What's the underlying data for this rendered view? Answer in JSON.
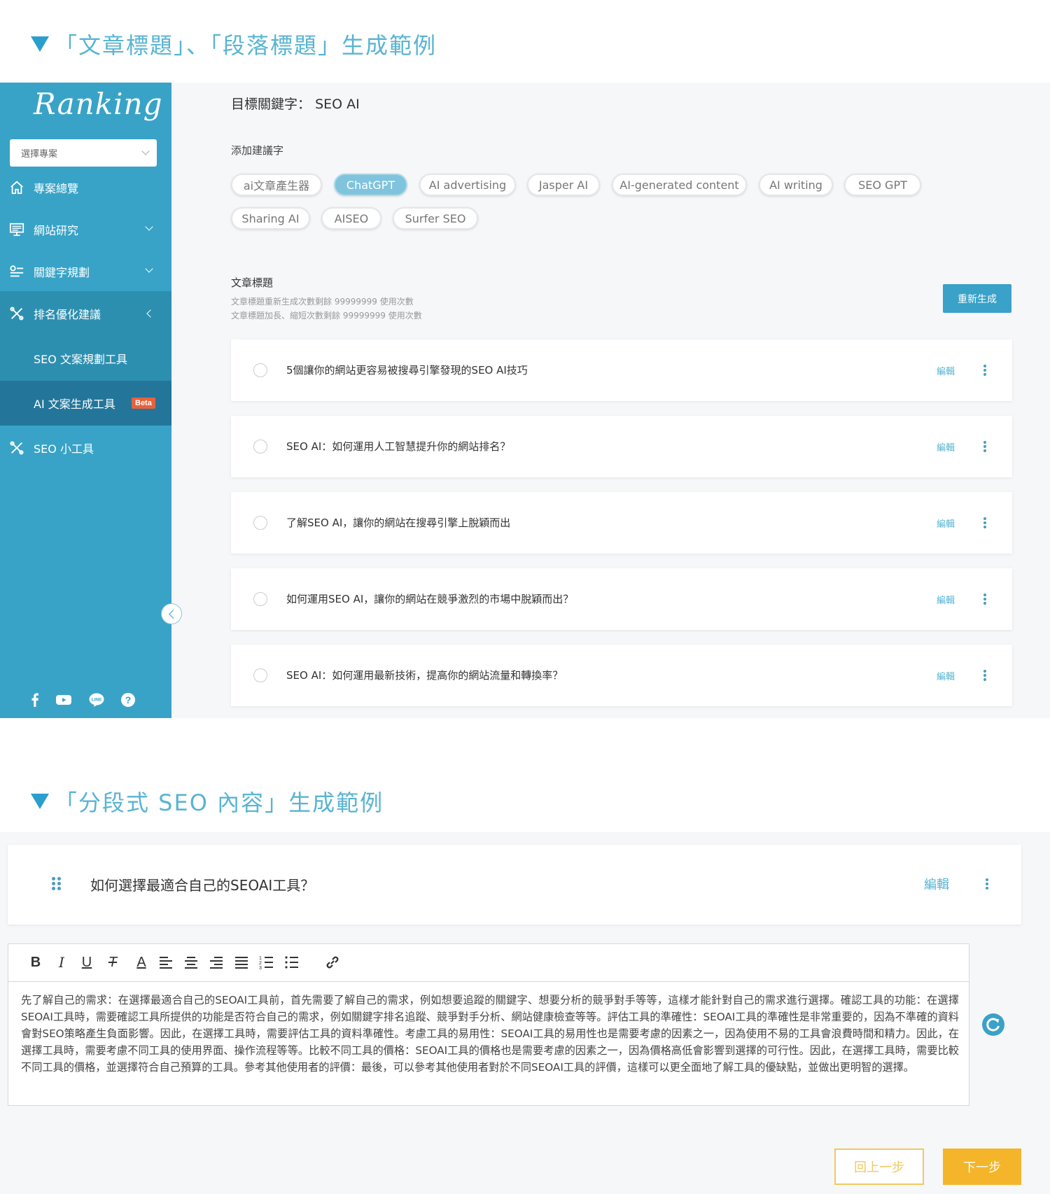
{
  "headings": {
    "section1": "「文章標題」、「段落標題」生成範例",
    "section2": "「分段式 SEO 內容」生成範例"
  },
  "sidebar": {
    "logo": "Ranking",
    "project_select_placeholder": "選擇專案",
    "items": [
      {
        "label": "專案總覽",
        "icon": "home-icon"
      },
      {
        "label": "網站研究",
        "icon": "monitor-icon"
      },
      {
        "label": "關鍵字規劃",
        "icon": "keyword-icon"
      },
      {
        "label": "排名優化建議",
        "icon": "tools-icon"
      },
      {
        "label": "SEO 文案規劃工具"
      },
      {
        "label": "AI 文案生成工具",
        "badge": "Beta"
      },
      {
        "label": "SEO 小工具",
        "icon": "tools-icon"
      }
    ],
    "social": [
      "facebook-icon",
      "youtube-icon",
      "line-icon",
      "help-icon"
    ]
  },
  "main": {
    "target_keyword_label": "目標關鍵字：",
    "target_keyword": "SEO AI",
    "add_suggestion_label": "添加建議字",
    "chips": [
      "ai文章產生器",
      "ChatGPT",
      "AI advertising",
      "Jasper AI",
      "AI-generated content",
      "AI writing",
      "SEO GPT",
      "Sharing AI",
      "AISEO",
      "Surfer SEO"
    ],
    "active_chip": "ChatGPT",
    "article_title_label": "文章標題",
    "regen_info": "文章標題重新生成次數剩餘 99999999 使用次數",
    "extend_info": "文章標題加長、縮短次數剩餘 99999999 使用次數",
    "regen_button": "重新生成",
    "edit_label": "編輯",
    "titles": [
      "5個讓你的網站更容易被搜尋引擎發現的SEO AI技巧",
      "SEO AI：如何運用人工智慧提升你的網站排名？",
      "了解SEO AI，讓你的網站在搜尋引擎上脫穎而出",
      "如何運用SEO AI，讓你的網站在競爭激烈的市場中脫穎而出？",
      "SEO AI：如何運用最新技術，提高你的網站流量和轉換率？"
    ]
  },
  "section": {
    "heading_text": "如何選擇最適合自己的SEOAI工具？",
    "edit_label": "編輯",
    "body": "先了解自己的需求：在選擇最適合自己的SEOAI工具前，首先需要了解自己的需求，例如想要追蹤的關鍵字、想要分析的競爭對手等等，這樣才能針對自己的需求進行選擇。確認工具的功能：在選擇SEOAI工具時，需要確認工具所提供的功能是否符合自己的需求，例如關鍵字排名追蹤、競爭對手分析、網站健康檢查等等。評估工具的準確性：SEOAI工具的準確性是非常重要的，因為不準確的資料會對SEO策略產生負面影響。因此，在選擇工具時，需要評估工具的資料準確性。考慮工具的易用性：SEOAI工具的易用性也是需要考慮的因素之一，因為使用不易的工具會浪費時間和精力。因此，在選擇工具時，需要考慮不同工具的使用界面、操作流程等等。比較不同工具的價格：SEOAI工具的價格也是需要考慮的因素之一，因為價格高低會影響到選擇的可行性。因此，在選擇工具時，需要比較不同工具的價格，並選擇符合自己預算的工具。參考其他使用者的評價：最後，可以參考其他使用者對於不同SEOAI工具的評價，這樣可以更全面地了解工具的優缺點，並做出更明智的選擇。"
  },
  "toolbar": {
    "bold": "B",
    "italic": "I",
    "underline": "U",
    "clear": "T",
    "color": "A"
  },
  "footer": {
    "prev_button": "回上一步",
    "next_button": "下一步"
  },
  "colors": {
    "sidebar": "#38a3c7",
    "accent": "#3aa1c8",
    "heading": "#58b4d2",
    "beta": "#e8613c",
    "next": "#f5b52a"
  }
}
